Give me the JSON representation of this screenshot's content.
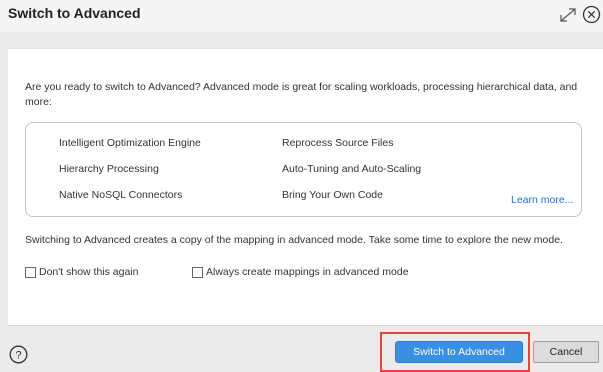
{
  "dialog": {
    "title": "Switch to Advanced",
    "intro": "Are you ready to switch to Advanced? Advanced mode is great for scaling workloads, processing hierarchical data, and more:",
    "features_left": [
      "Intelligent Optimization Engine",
      "Hierarchy Processing",
      "Native NoSQL Connectors"
    ],
    "features_right": [
      "Reprocess Source Files",
      "Auto-Tuning and Auto-Scaling",
      "Bring Your Own Code"
    ],
    "learn_more": "Learn more...",
    "copy_note": "Switching to Advanced creates a copy of the mapping in advanced mode. Take some time to explore the new mode.",
    "dont_show": "Don't show this again",
    "always_create": "Always create mappings in advanced mode",
    "primary_button": "Switch to Advanced",
    "cancel_button": "Cancel",
    "icons": [
      "expand-icon",
      "close-icon",
      "help-icon"
    ],
    "accent_color": "#3b8fe3",
    "highlight_color": "#e74343"
  }
}
